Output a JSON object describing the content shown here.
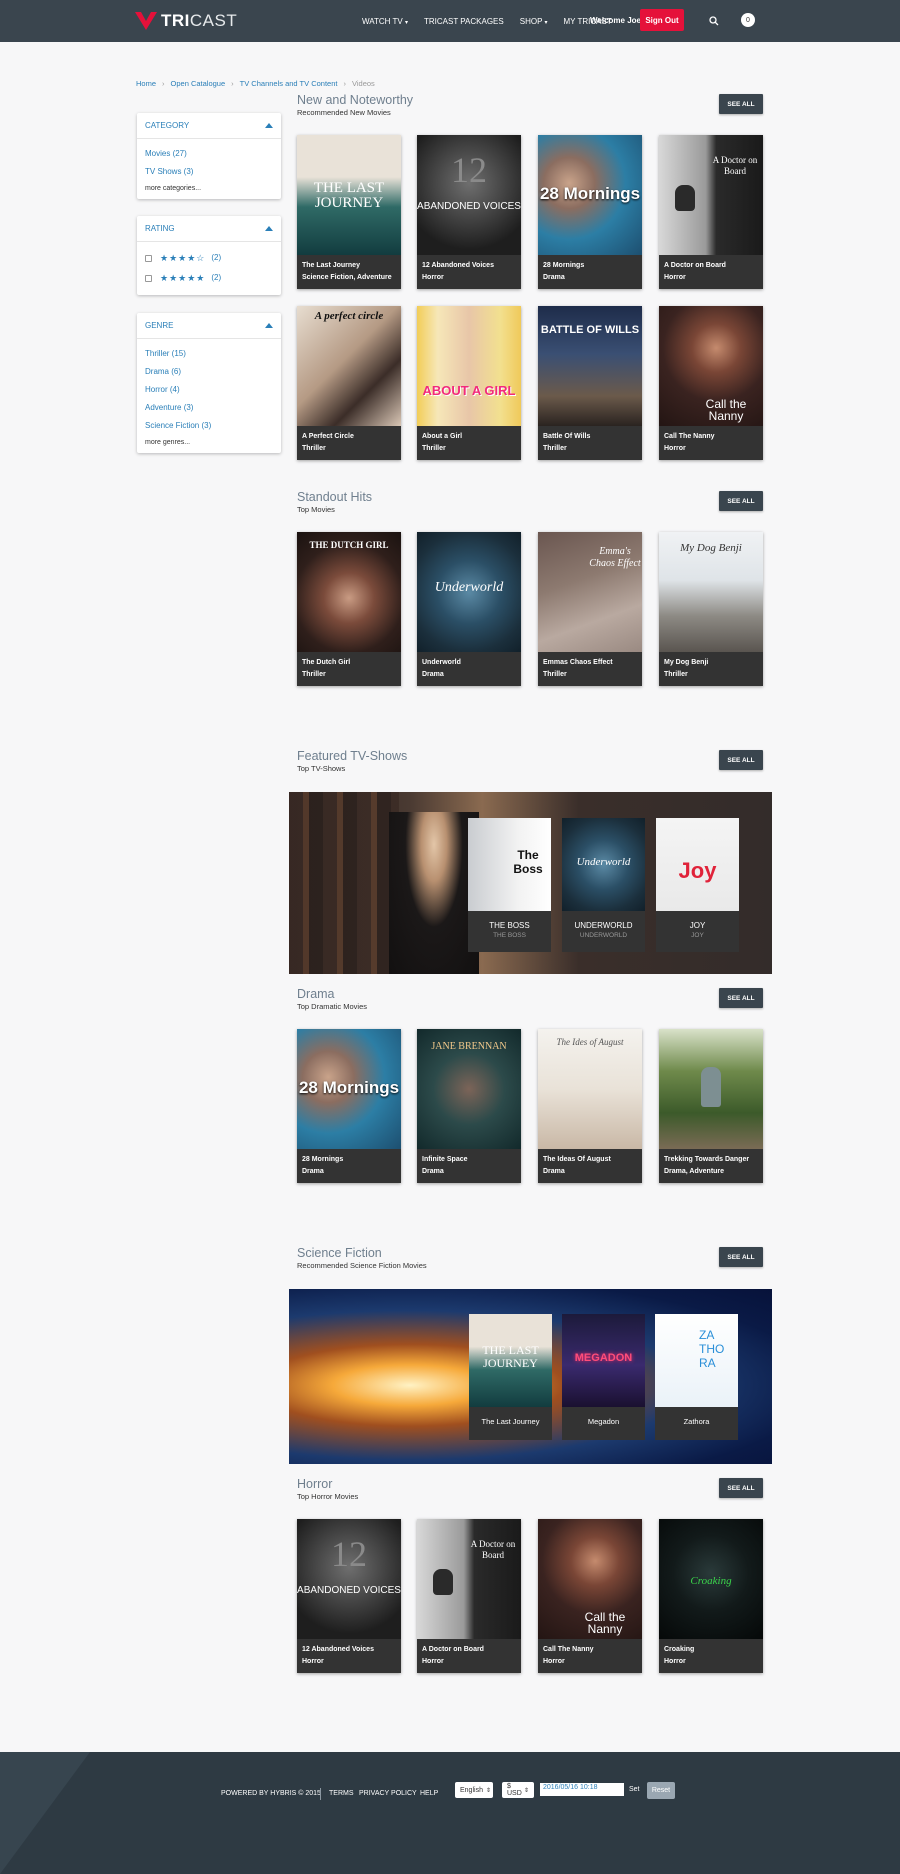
{
  "brand": {
    "logo_bold": "TRI",
    "logo_rest": "CAST",
    "accent": "#e5113a"
  },
  "nav": {
    "items": [
      "WATCH TV",
      "TRICAST PACKAGES",
      "SHOP",
      "MY TRICAST"
    ],
    "welcome": "Welcome Joe",
    "signout": "Sign Out",
    "cart_count": "0"
  },
  "breadcrumb": [
    "Home",
    "Open Catalogue",
    "TV Channels and TV Content",
    "Videos"
  ],
  "facets": {
    "category": {
      "title": "CATEGORY",
      "items": [
        "Movies (27)",
        "TV Shows (3)"
      ],
      "more": "more categories..."
    },
    "rating": {
      "title": "RATING",
      "items": [
        {
          "stars": "★★★★☆",
          "count": "(2)"
        },
        {
          "stars": "★★★★★",
          "count": "(2)"
        }
      ]
    },
    "genre": {
      "title": "GENRE",
      "items": [
        "Thriller (15)",
        "Drama (6)",
        "Horror (4)",
        "Adventure (3)",
        "Science Fiction (3)"
      ],
      "more": "more genres..."
    }
  },
  "see_all": "SEE ALL",
  "sections": {
    "new": {
      "title": "New and Noteworthy",
      "sub": "Recommended New Movies",
      "cards": [
        {
          "title": "The Last Journey",
          "genre": "Science Fiction, Adventure",
          "poster": "THE LAST JOURNEY"
        },
        {
          "title": "12 Abandoned Voices",
          "genre": "Horror",
          "poster": "ABANDONED VOICES"
        },
        {
          "title": "28 Mornings",
          "genre": "Drama",
          "poster": "28 Mornings"
        },
        {
          "title": "A Doctor on Board",
          "genre": "Horror",
          "poster": "A Doctor on Board"
        },
        {
          "title": "A Perfect Circle",
          "genre": "Thriller",
          "poster": "A perfect circle"
        },
        {
          "title": "About a Girl",
          "genre": "Thriller",
          "poster": "ABOUT A GIRL"
        },
        {
          "title": "Battle Of Wills",
          "genre": "Thriller",
          "poster": "BATTLE OF WILLS"
        },
        {
          "title": "Call The Nanny",
          "genre": "Horror",
          "poster": "Call the Nanny"
        }
      ]
    },
    "hits": {
      "title": "Standout Hits",
      "sub": "Top Movies",
      "cards": [
        {
          "title": "The Dutch Girl",
          "genre": "Thriller",
          "poster": "THE DUTCH GIRL"
        },
        {
          "title": "Underworld",
          "genre": "Drama",
          "poster": "Underworld"
        },
        {
          "title": "Emmas Chaos Effect",
          "genre": "Thriller",
          "poster": "Emma's Chaos Effect"
        },
        {
          "title": "My Dog Benji",
          "genre": "Thriller",
          "poster": "My Dog Benji"
        }
      ]
    },
    "tvshows": {
      "title": "Featured TV-Shows",
      "sub": "Top TV-Shows",
      "cards": [
        {
          "label": "THE BOSS",
          "sub": "THE BOSS",
          "poster": "The Boss"
        },
        {
          "label": "UNDERWORLD",
          "sub": "UNDERWORLD",
          "poster": "Underworld"
        },
        {
          "label": "JOY",
          "sub": "JOY",
          "poster": "Joy"
        }
      ]
    },
    "drama": {
      "title": "Drama",
      "sub": "Top Dramatic Movies",
      "cards": [
        {
          "title": "28 Mornings",
          "genre": "Drama",
          "poster": "28 Mornings"
        },
        {
          "title": "Infinite Space",
          "genre": "Drama",
          "poster": "JANE BRENNAN"
        },
        {
          "title": "The Ideas Of August",
          "genre": "Drama",
          "poster": "The Ides of August"
        },
        {
          "title": "Trekking Towards Danger",
          "genre": "Drama, Adventure",
          "poster": ""
        }
      ]
    },
    "scifi": {
      "title": "Science Fiction",
      "sub": "Recommended Science Fiction Movies",
      "cards": [
        {
          "label": "The Last Journey",
          "poster": "THE LAST JOURNEY"
        },
        {
          "label": "Megadon",
          "poster": "MEGADON"
        },
        {
          "label": "Zathora",
          "poster": "ZA THO RA"
        }
      ]
    },
    "horror": {
      "title": "Horror",
      "sub": "Top Horror Movies",
      "cards": [
        {
          "title": "12 Abandoned Voices",
          "genre": "Horror",
          "poster": "ABANDONED VOICES"
        },
        {
          "title": "A Doctor on Board",
          "genre": "Horror",
          "poster": "A Doctor on Board"
        },
        {
          "title": "Call The Nanny",
          "genre": "Horror",
          "poster": "Call the Nanny"
        },
        {
          "title": "Croaking",
          "genre": "Horror",
          "poster": "Croaking"
        }
      ]
    }
  },
  "footer": {
    "powered": "POWERED BY HYBRIS © 2015",
    "links": [
      "TERMS",
      "PRIVACY POLICY",
      "HELP"
    ],
    "language": "English",
    "currency": "$ USD",
    "date": "2016/05/16 10:18",
    "set": "Set",
    "reset": "Reset"
  }
}
